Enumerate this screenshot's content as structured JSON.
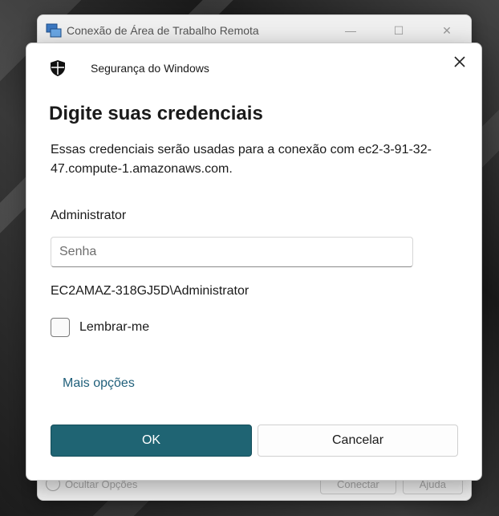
{
  "rdc_window": {
    "title": "Conexão de Área de Trabalho Remota",
    "hide_options": "Ocultar Opções",
    "connect_label": "Conectar",
    "help_label": "Ajuda"
  },
  "dialog": {
    "app_name": "Segurança do Windows",
    "title": "Digite suas credenciais",
    "description": "Essas credenciais serão usadas para a conexão com ec2-3-91-32-47.compute-1.amazonaws.com.",
    "username": "Administrator",
    "password_placeholder": "Senha",
    "domain_user": "EC2AMAZ-318GJ5D\\Administrator",
    "remember_label": "Lembrar-me",
    "more_options": "Mais opções",
    "ok_label": "OK",
    "cancel_label": "Cancelar"
  },
  "colors": {
    "accent": "#1f6473",
    "link": "#1f5f7a"
  },
  "icons": {
    "app": "shield-icon",
    "close": "close-icon",
    "rdc": "remote-desktop-icon"
  }
}
